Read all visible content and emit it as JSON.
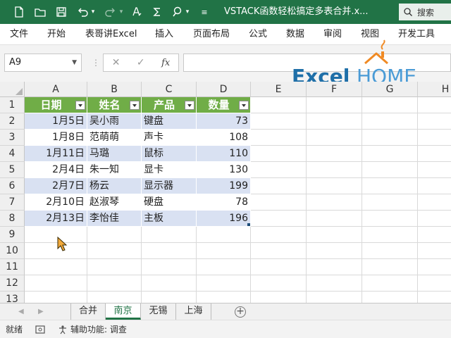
{
  "window": {
    "title": "VSTACK函数轻松搞定多表合并.x...",
    "search_label": "搜索",
    "theme_color": "#217346"
  },
  "ribbon": {
    "tabs": [
      "文件",
      "开始",
      "表哥讲Excel",
      "插入",
      "页面布局",
      "公式",
      "数据",
      "审阅",
      "视图",
      "开发工具"
    ]
  },
  "formula_bar": {
    "name_box": "A9",
    "cancel_icon": "✕",
    "enter_icon": "✓",
    "fx_label": "fx",
    "formula": ""
  },
  "logo": {
    "text_excel": "Excel",
    "text_home": "HOME",
    "name": "excelhome-logo"
  },
  "grid": {
    "columns": [
      "A",
      "B",
      "C",
      "D",
      "E",
      "F",
      "G",
      "H"
    ],
    "rows": [
      "1",
      "2",
      "3",
      "4",
      "5",
      "6",
      "7",
      "8",
      "9",
      "10",
      "11",
      "12",
      "13"
    ],
    "table": {
      "headers": [
        "日期",
        "姓名",
        "产品",
        "数量"
      ],
      "header_color": "#70ad47",
      "band_color": "#d9e1f2",
      "records": [
        [
          "1月5日",
          "吴小雨",
          "键盘",
          "73"
        ],
        [
          "1月8日",
          "范萌萌",
          "声卡",
          "108"
        ],
        [
          "1月11日",
          "马璐",
          "鼠标",
          "110"
        ],
        [
          "2月4日",
          "朱一知",
          "显卡",
          "130"
        ],
        [
          "2月7日",
          "杨云",
          "显示器",
          "199"
        ],
        [
          "2月10日",
          "赵淑琴",
          "硬盘",
          "78"
        ],
        [
          "2月13日",
          "李怡佳",
          "主板",
          "196"
        ]
      ]
    }
  },
  "sheets": {
    "tabs": [
      "合并",
      "南京",
      "无锡",
      "上海"
    ],
    "active": "南京",
    "add_label": "+"
  },
  "status": {
    "ready": "就绪",
    "accessibility": "辅助功能: 调查"
  }
}
